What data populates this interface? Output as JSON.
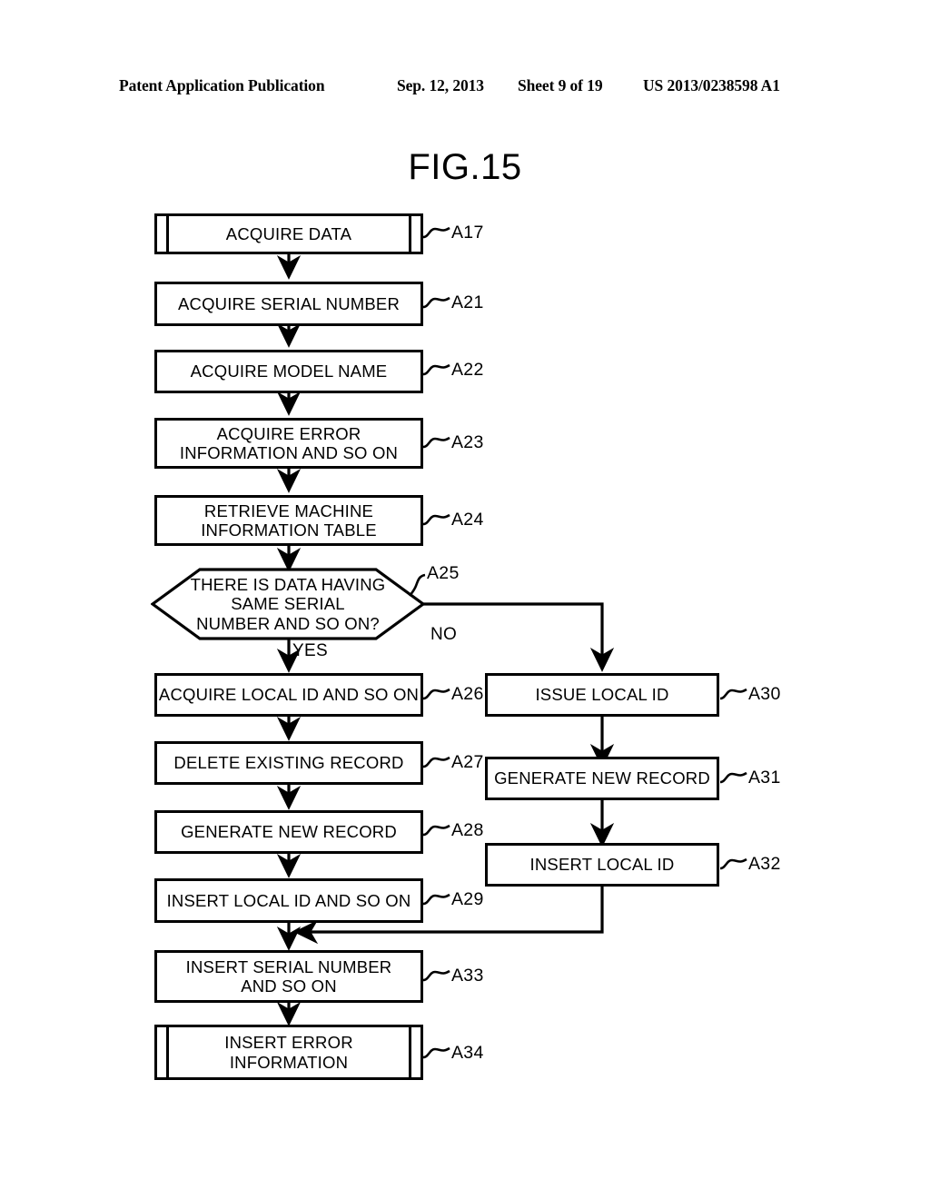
{
  "header": {
    "publication": "Patent Application Publication",
    "date": "Sep. 12, 2013",
    "sheet": "Sheet 9 of 19",
    "patent_number": "US 2013/0238598 A1"
  },
  "figure": {
    "title": "FIG.15"
  },
  "colors": {
    "ink": "#000000",
    "paper": "#ffffff"
  },
  "nodes": {
    "a17": {
      "text": "ACQUIRE DATA",
      "ref": "A17",
      "shape": "predefined-process"
    },
    "a21": {
      "text": "ACQUIRE SERIAL NUMBER",
      "ref": "A21",
      "shape": "process"
    },
    "a22": {
      "text": "ACQUIRE MODEL NAME",
      "ref": "A22",
      "shape": "process"
    },
    "a23": {
      "text": "ACQUIRE ERROR\nINFORMATION AND SO ON",
      "ref": "A23",
      "shape": "process"
    },
    "a24": {
      "text": "RETRIEVE MACHINE\nINFORMATION TABLE",
      "ref": "A24",
      "shape": "process"
    },
    "a25": {
      "text": "THERE IS DATA HAVING\nSAME SERIAL\nNUMBER AND SO ON?",
      "ref": "A25",
      "shape": "decision"
    },
    "a26": {
      "text": "ACQUIRE LOCAL ID AND SO ON",
      "ref": "A26",
      "shape": "process"
    },
    "a27": {
      "text": "DELETE EXISTING RECORD",
      "ref": "A27",
      "shape": "process"
    },
    "a28": {
      "text": "GENERATE NEW RECORD",
      "ref": "A28",
      "shape": "process"
    },
    "a29": {
      "text": "INSERT LOCAL ID AND SO ON",
      "ref": "A29",
      "shape": "process"
    },
    "a30": {
      "text": "ISSUE LOCAL ID",
      "ref": "A30",
      "shape": "process"
    },
    "a31": {
      "text": "GENERATE NEW RECORD",
      "ref": "A31",
      "shape": "process"
    },
    "a32": {
      "text": "INSERT LOCAL ID",
      "ref": "A32",
      "shape": "process"
    },
    "a33": {
      "text": "INSERT SERIAL NUMBER\nAND SO ON",
      "ref": "A33",
      "shape": "process"
    },
    "a34": {
      "text": "INSERT ERROR\nINFORMATION",
      "ref": "A34",
      "shape": "predefined-process"
    }
  },
  "edge_labels": {
    "yes": "YES",
    "no": "NO"
  }
}
